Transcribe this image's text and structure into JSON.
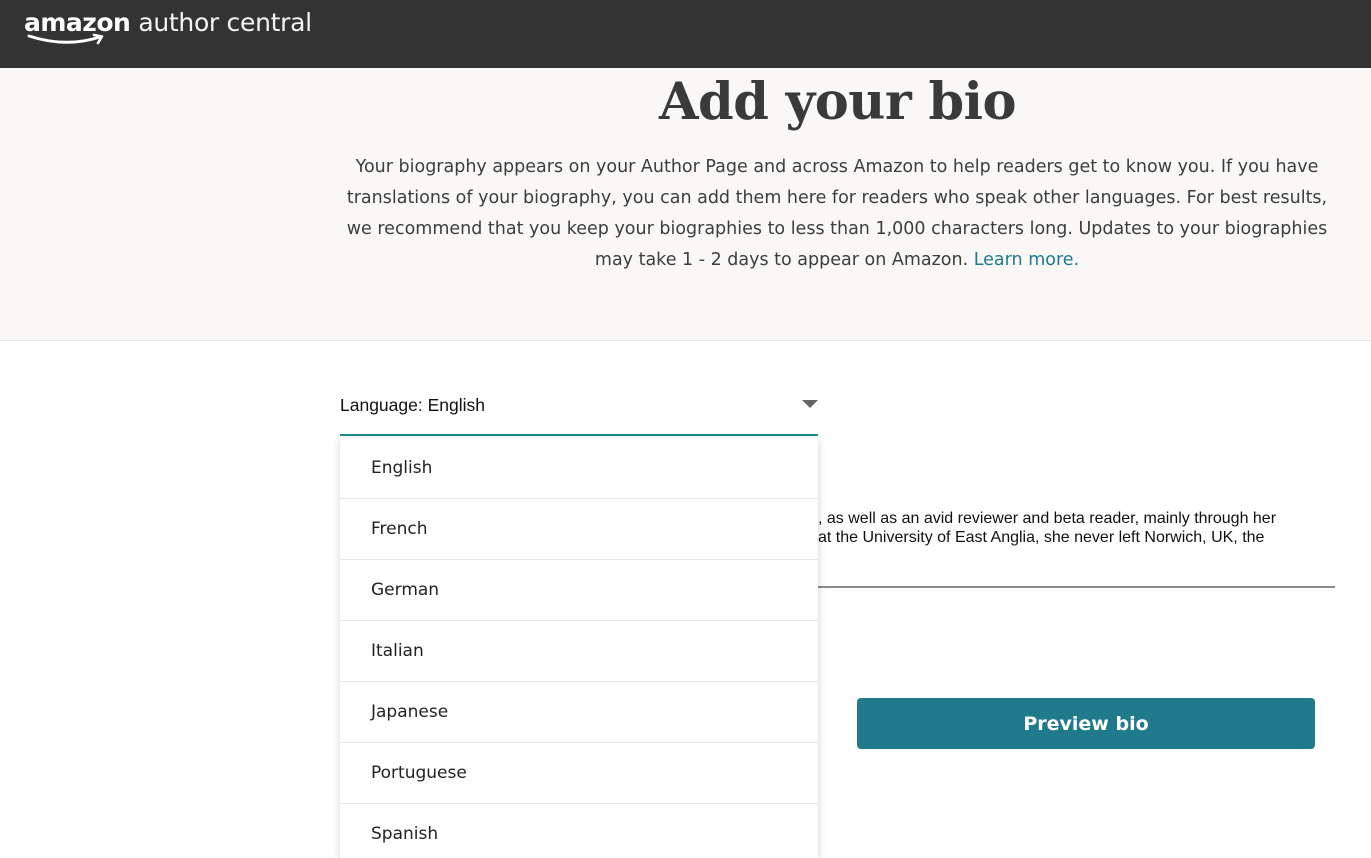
{
  "header": {
    "logo_brand": "amazon",
    "logo_product": "author central",
    "background_color": "#333333"
  },
  "hero": {
    "title": "Add your bio",
    "description": "Your biography appears on your Author Page and across Amazon to help readers get to know you. If you have translations of your biography, you can add them here for readers who speak other languages. For best results, we recommend that you keep your biographies to less than 1,000 characters long. Updates to your biographies may take 1 - 2 days to appear on Amazon.",
    "learn_more_link": "Learn more."
  },
  "language_select": {
    "label": "Language: English",
    "caret_icon": "chevron-down-icon",
    "accent_color": "#1e8a8f"
  },
  "language_dropdown": {
    "options": [
      {
        "label": "English"
      },
      {
        "label": "French"
      },
      {
        "label": "German"
      },
      {
        "label": "Italian"
      },
      {
        "label": "Japanese"
      },
      {
        "label": "Portuguese"
      },
      {
        "label": "Spanish"
      }
    ]
  },
  "bio_field": {
    "visible_lines": [
      ", as well as an avid reviewer and beta reader, mainly through her",
      "at the University of East Anglia, she never left Norwich, UK, the"
    ]
  },
  "actions": {
    "preview_label": "Preview bio",
    "preview_color": "#1f7a8c"
  }
}
